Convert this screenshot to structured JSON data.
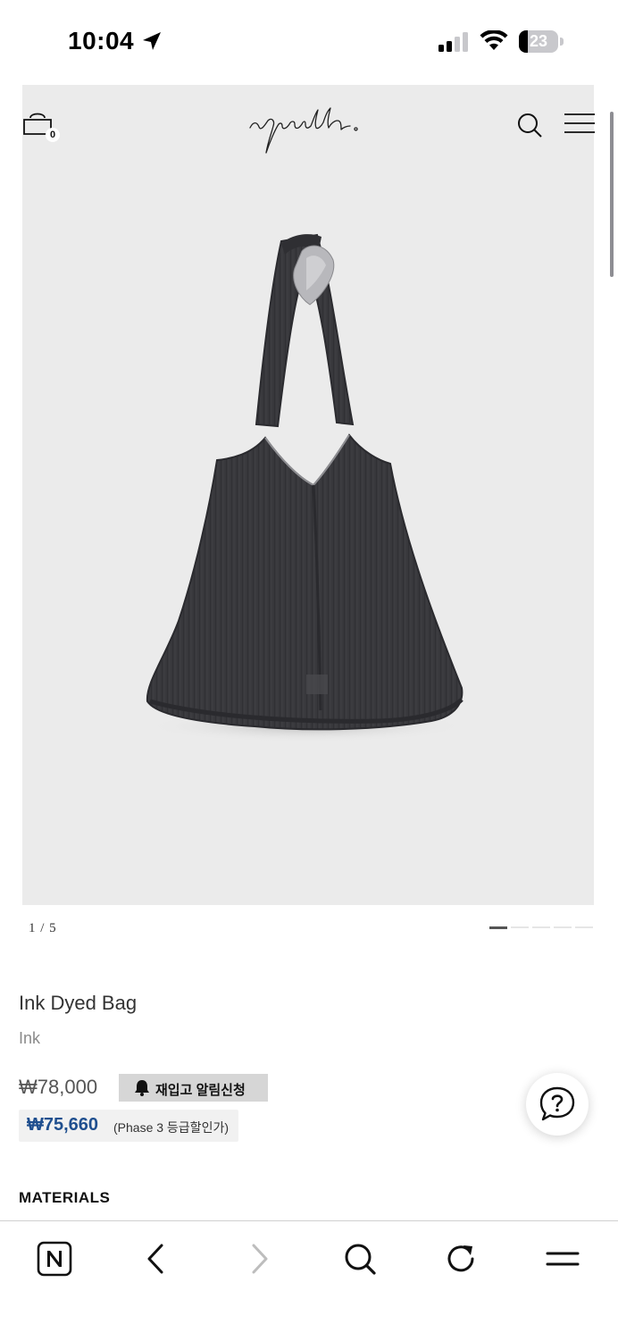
{
  "status_bar": {
    "time": "10:04",
    "battery_level": "23",
    "battery_fraction": 0.23
  },
  "header": {
    "cart_count": "0",
    "logo_text": "youth.",
    "icons": [
      "cart-icon",
      "search-icon",
      "hamburger-menu-icon"
    ]
  },
  "gallery": {
    "counter": "1 / 5",
    "current_index": 1,
    "total": 5
  },
  "product": {
    "name": "Ink Dyed Bag",
    "color": "Ink",
    "price": "₩78,000",
    "restock_button": "재입고 알림신청",
    "member_price": "₩75,660",
    "member_note": "(Phase 3 등급할인가)"
  },
  "sections": {
    "materials": "MATERIALS"
  },
  "help_button": {
    "icon": "question-bubble-icon"
  },
  "browser_toolbar": {
    "icons": [
      "naver-home-icon",
      "back-icon",
      "forward-icon",
      "search-icon",
      "reload-icon",
      "menu-icon"
    ]
  },
  "colors": {
    "member_price": "#1f4f8f",
    "hero_background": "#ebebeb",
    "restock_button_bg": "#d6d6d6"
  }
}
